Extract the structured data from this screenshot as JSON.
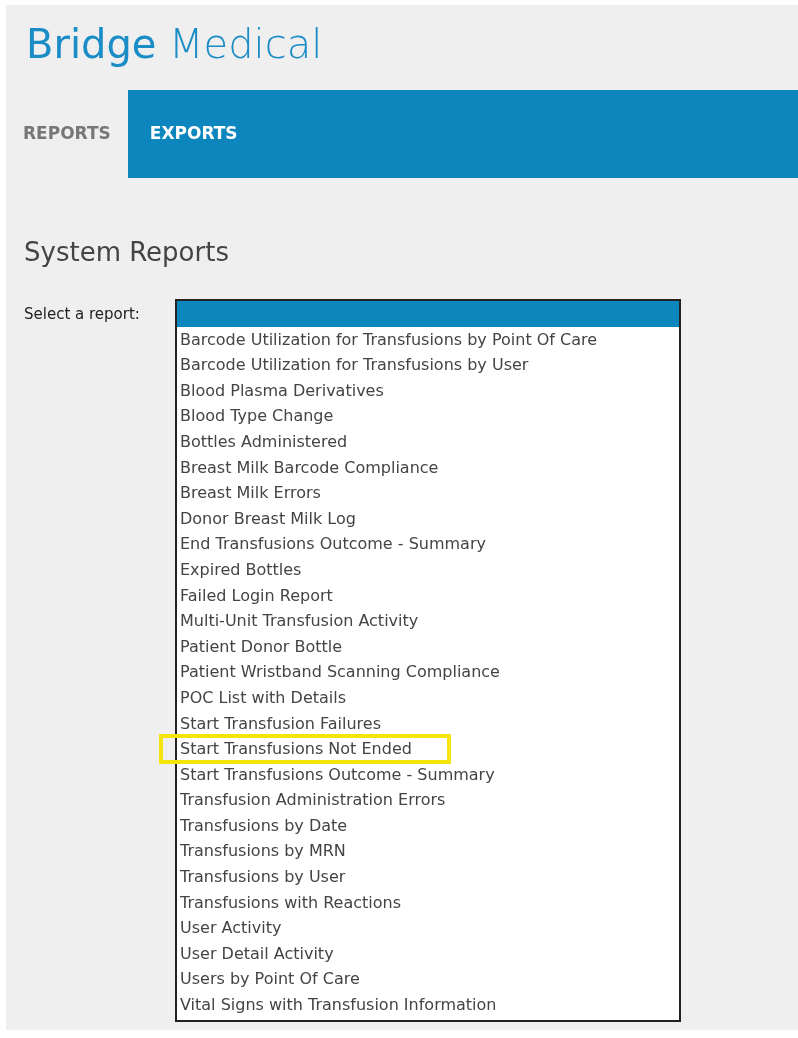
{
  "brand": "**Bridge** Medical",
  "tabs": [
    {
      "label": "REPORTS",
      "selected": true
    },
    {
      "label": "EXPORTS",
      "selected": false
    }
  ],
  "heading": "System Reports",
  "report_select": {
    "label": "Select a report:",
    "options": [
      {
        "selected": true
      },
      {
        "label": "Barcode Utilization for Transfusions by Point Of Care",
        "selected": false
      },
      {
        "label": "Barcode Utilization for Transfusions by User",
        "selected": false
      },
      {
        "label": "Blood Plasma Derivatives",
        "selected": false
      },
      {
        "label": "Blood Type Change",
        "selected": false
      },
      {
        "label": "Bottles Administered",
        "selected": false
      },
      {
        "label": "Breast Milk Barcode Compliance",
        "selected": false
      },
      {
        "label": "Breast Milk Errors",
        "selected": false
      },
      {
        "label": "Donor Breast Milk Log",
        "selected": false
      },
      {
        "label": "End Transfusions Outcome - Summary",
        "selected": false
      },
      {
        "label": "Expired Bottles",
        "selected": false
      },
      {
        "label": "Failed Login Report",
        "selected": false
      },
      {
        "label": "Multi-Unit Transfusion Activity",
        "selected": false
      },
      {
        "label": "Patient Donor Bottle",
        "selected": false
      },
      {
        "label": "Patient Wristband Scanning Compliance",
        "selected": false
      },
      {
        "label": "POC List with Details",
        "selected": false
      },
      {
        "label": "Start Transfusion Failures",
        "selected": false
      },
      {
        "label": "Start Transfusions Not Ended",
        "selected": false,
        "highlighted": true
      },
      {
        "label": "Start Transfusions Outcome - Summary",
        "selected": false
      },
      {
        "label": "Transfusion Administration Errors",
        "selected": false
      },
      {
        "label": "Transfusions by Date",
        "selected": false
      },
      {
        "label": "Transfusions by MRN",
        "selected": false
      },
      {
        "label": "Transfusions by User",
        "selected": false
      },
      {
        "label": "Transfusions with Reactions",
        "selected": false
      },
      {
        "label": "User Activity",
        "selected": false
      },
      {
        "label": "User Detail Activity",
        "selected": false
      },
      {
        "label": "Users by Point Of Care",
        "selected": false
      },
      {
        "label": "Vital Signs with Transfusion Information",
        "selected": false
      }
    ]
  }
}
